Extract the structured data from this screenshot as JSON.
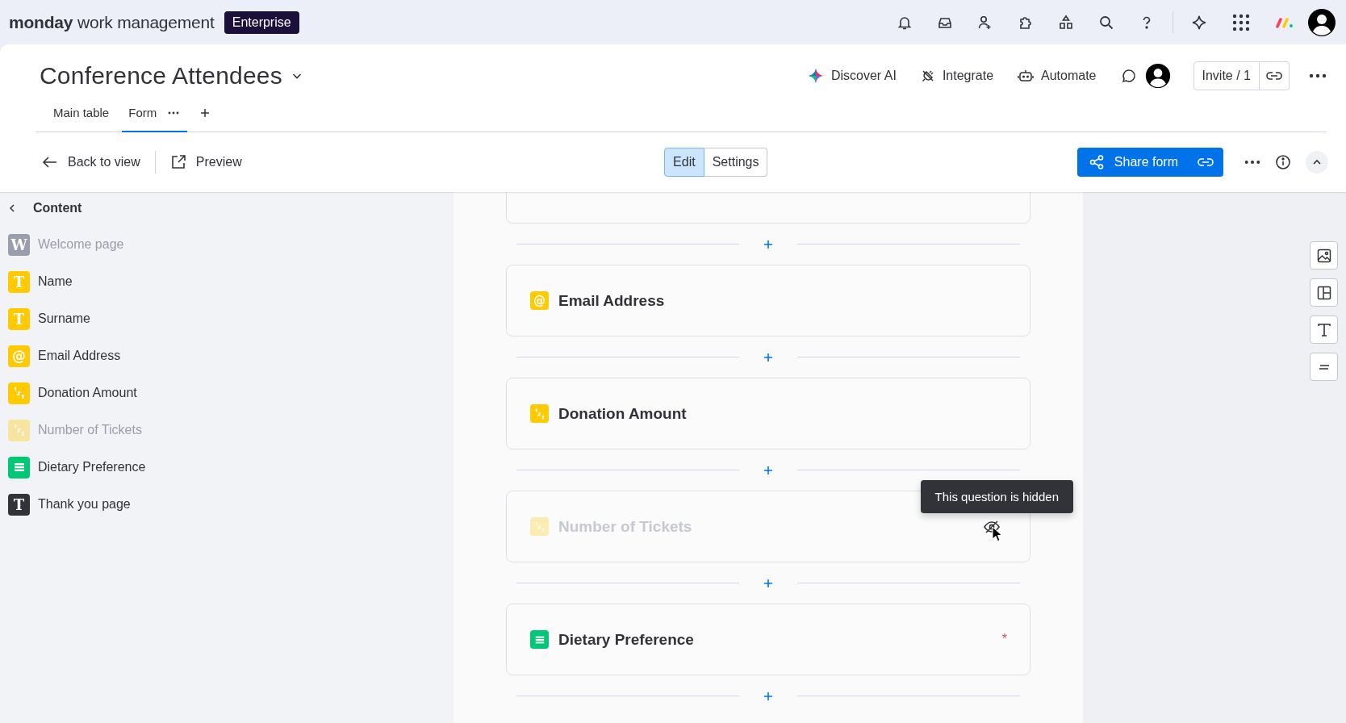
{
  "top_bar": {
    "brand_bold": "monday",
    "brand_rest": "work management",
    "plan_badge": "Enterprise"
  },
  "board": {
    "title": "Conference Attendees",
    "tabs": [
      {
        "label": "Main table",
        "selected": false
      },
      {
        "label": "Form",
        "selected": true
      }
    ],
    "actions": [
      {
        "kind": "ai",
        "label": "Discover AI"
      },
      {
        "kind": "integrate",
        "label": "Integrate"
      },
      {
        "kind": "automate",
        "label": "Automate"
      }
    ],
    "invite": "Invite / 1"
  },
  "toolbar": {
    "back": "Back to view",
    "preview": "Preview",
    "modes": [
      {
        "label": "Edit",
        "selected": true
      },
      {
        "label": "Settings",
        "selected": false
      }
    ],
    "share": "Share form"
  },
  "sidebar": {
    "heading": "Content",
    "items": [
      {
        "kind": "welcome",
        "glyph": "W",
        "label": "Welcome page",
        "hidden": true
      },
      {
        "kind": "text",
        "glyph": "T",
        "label": "Name",
        "hidden": false
      },
      {
        "kind": "text",
        "glyph": "T",
        "label": "Surname",
        "hidden": false
      },
      {
        "kind": "email",
        "glyph": "@",
        "label": "Email Address",
        "hidden": false
      },
      {
        "kind": "number",
        "label": "Donation Amount",
        "hidden": false
      },
      {
        "kind": "number",
        "label": "Number of Tickets",
        "hidden": true
      },
      {
        "kind": "dropdown",
        "label": "Dietary Preference",
        "hidden": false
      },
      {
        "kind": "thank_you",
        "glyph": "T",
        "label": "Thank you page",
        "hidden": false
      }
    ]
  },
  "form": {
    "questions": [
      {
        "kind": "email",
        "glyph": "@",
        "title": "Email Address",
        "hidden": false,
        "required": false
      },
      {
        "kind": "number",
        "title": "Donation Amount",
        "hidden": false,
        "required": false
      },
      {
        "kind": "number",
        "title": "Number of Tickets",
        "hidden": true,
        "required": false
      },
      {
        "kind": "dropdown",
        "title": "Dietary Preference",
        "hidden": false,
        "required": true
      }
    ],
    "tooltip": "This question is hidden",
    "required_mark": "*"
  }
}
